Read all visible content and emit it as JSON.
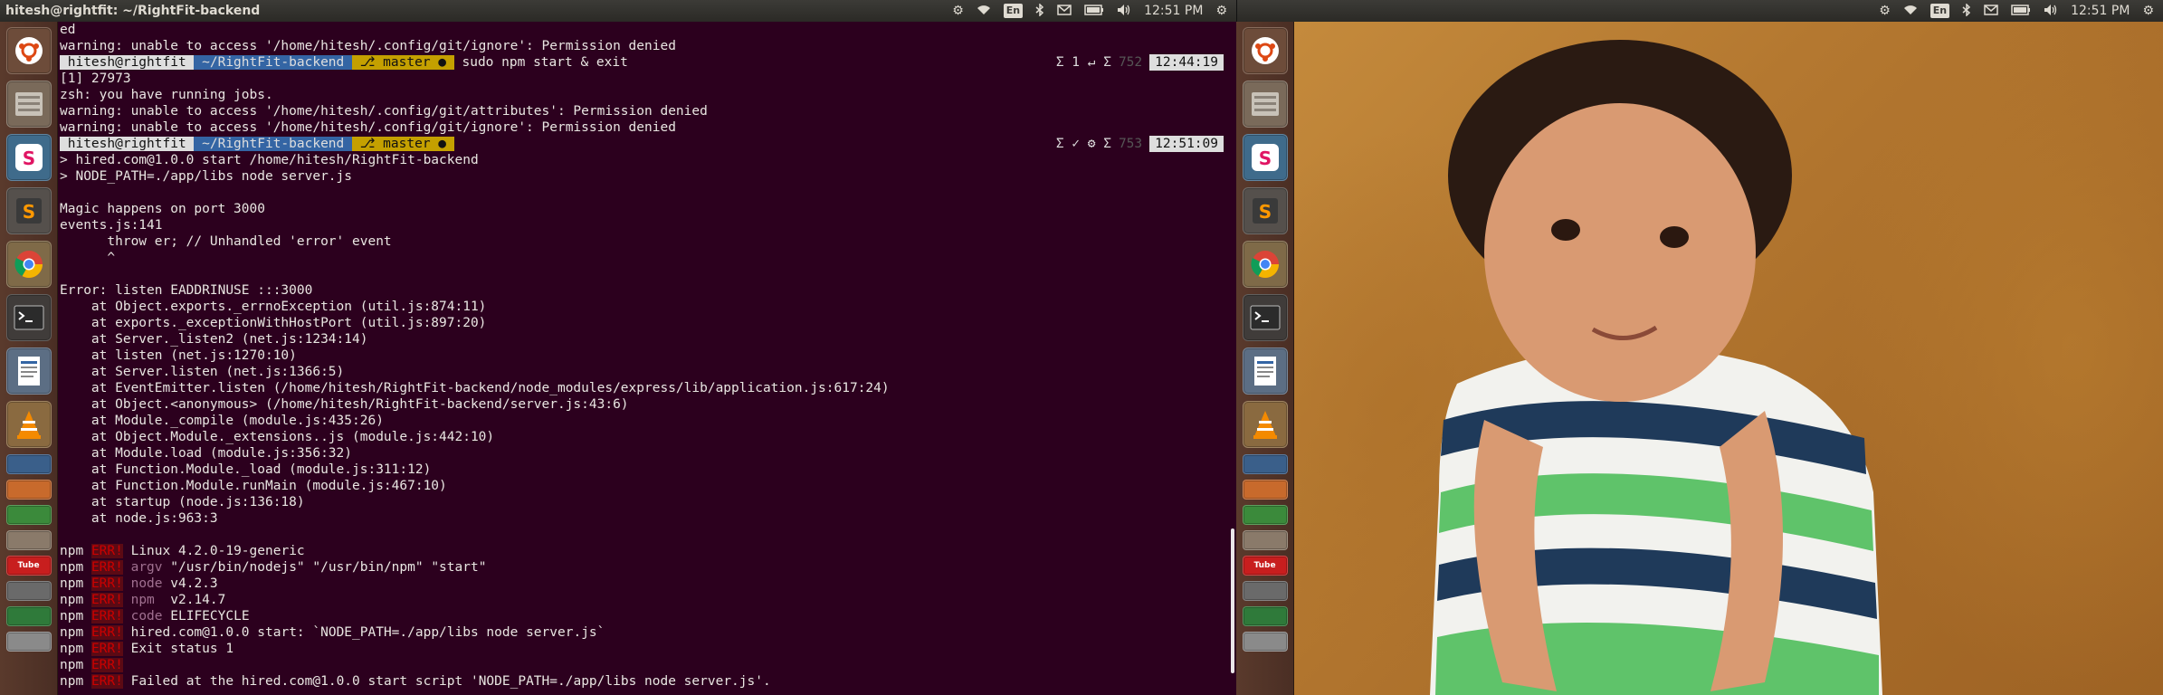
{
  "window": {
    "title": "hitesh@rightfit: ~/RightFit-backend"
  },
  "panel": {
    "keyboard": "En",
    "time": "12:51 PM"
  },
  "launcher": {
    "items": [
      {
        "name": "ubuntu-dash"
      },
      {
        "name": "files"
      },
      {
        "name": "slack"
      },
      {
        "name": "sublime-text"
      },
      {
        "name": "chrome"
      },
      {
        "name": "terminal"
      },
      {
        "name": "text-editor"
      },
      {
        "name": "vlc"
      }
    ],
    "stack_labels": {
      "youtube": "Tube"
    }
  },
  "terminal": {
    "lines": [
      {
        "text": "ed"
      },
      {
        "text": "warning: unable to access '/home/hitesh/.config/git/ignore': Permission denied"
      },
      {
        "prompt": {
          "user": " hitesh@rightfit ",
          "dir": " ~/RightFit-backend ",
          "git": " ⎇ master ● ",
          "cmd": " sudo npm start & exit",
          "right": {
            "jobs": "Σ 1 ↵ Σ",
            "dim": "752",
            "time": "12:44:19"
          }
        }
      },
      {
        "text": "[1] 27973"
      },
      {
        "text": "zsh: you have running jobs."
      },
      {
        "text": "warning: unable to access '/home/hitesh/.config/git/attributes': Permission denied"
      },
      {
        "text": "warning: unable to access '/home/hitesh/.config/git/ignore': Permission denied"
      },
      {
        "prompt": {
          "user": " hitesh@rightfit ",
          "dir": " ~/RightFit-backend ",
          "git": " ⎇ master ● ",
          "cmd": "",
          "right": {
            "jobs": "Σ ✓ ⚙ Σ",
            "dim": "753",
            "time": "12:51:09"
          }
        }
      },
      {
        "text": "> hired.com@1.0.0 start /home/hitesh/RightFit-backend"
      },
      {
        "text": "> NODE_PATH=./app/libs node server.js"
      },
      {
        "text": ""
      },
      {
        "text": "Magic happens on port 3000"
      },
      {
        "text": "events.js:141"
      },
      {
        "text": "      throw er; // Unhandled 'error' event"
      },
      {
        "text": "      ^"
      },
      {
        "text": ""
      },
      {
        "text": "Error: listen EADDRINUSE :::3000"
      },
      {
        "text": "    at Object.exports._errnoException (util.js:874:11)"
      },
      {
        "text": "    at exports._exceptionWithHostPort (util.js:897:20)"
      },
      {
        "text": "    at Server._listen2 (net.js:1234:14)"
      },
      {
        "text": "    at listen (net.js:1270:10)"
      },
      {
        "text": "    at Server.listen (net.js:1366:5)"
      },
      {
        "text": "    at EventEmitter.listen (/home/hitesh/RightFit-backend/node_modules/express/lib/application.js:617:24)"
      },
      {
        "text": "    at Object.<anonymous> (/home/hitesh/RightFit-backend/server.js:43:6)"
      },
      {
        "text": "    at Module._compile (module.js:435:26)"
      },
      {
        "text": "    at Object.Module._extensions..js (module.js:442:10)"
      },
      {
        "text": "    at Module.load (module.js:356:32)"
      },
      {
        "text": "    at Function.Module._load (module.js:311:12)"
      },
      {
        "text": "    at Function.Module.runMain (module.js:467:10)"
      },
      {
        "text": "    at startup (node.js:136:18)"
      },
      {
        "text": "    at node.js:963:3"
      },
      {
        "text": ""
      },
      {
        "npm": {
          "key": "",
          "val": "Linux 4.2.0-19-generic"
        }
      },
      {
        "npm": {
          "key": "argv",
          "val": "\"/usr/bin/nodejs\" \"/usr/bin/npm\" \"start\""
        }
      },
      {
        "npm": {
          "key": "node",
          "val": "v4.2.3"
        }
      },
      {
        "npm": {
          "key": "npm ",
          "val": "v2.14.7"
        }
      },
      {
        "npm": {
          "key": "code",
          "val": "ELIFECYCLE"
        }
      },
      {
        "npm": {
          "key": "",
          "val": "hired.com@1.0.0 start: `NODE_PATH=./app/libs node server.js`"
        }
      },
      {
        "npm": {
          "key": "",
          "val": "Exit status 1"
        }
      },
      {
        "npm": {
          "key": "",
          "val": ""
        }
      },
      {
        "npm": {
          "key": "",
          "val": "Failed at the hired.com@1.0.0 start script 'NODE_PATH=./app/libs node server.js'."
        }
      }
    ],
    "npm_prefix": "npm",
    "err_tag": "ERR!"
  },
  "colors": {
    "terminal_bg": "#2c001e",
    "prompt_dir": "#3465a4",
    "prompt_git": "#c4a000",
    "npm_err": "#cc0000"
  }
}
